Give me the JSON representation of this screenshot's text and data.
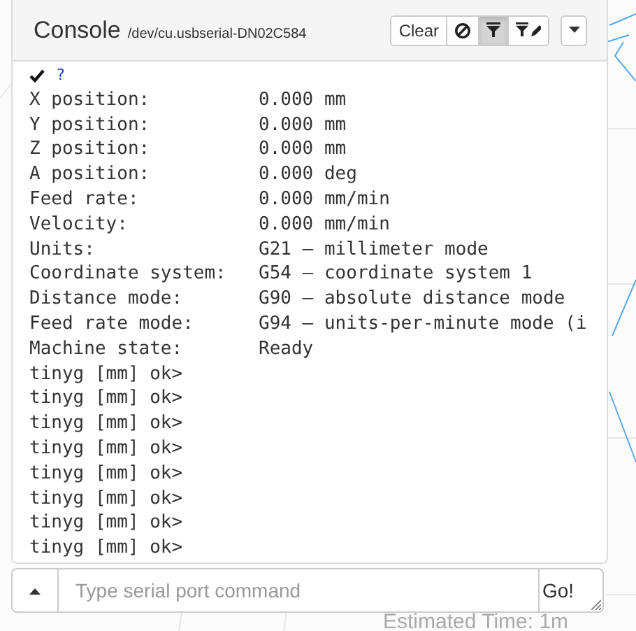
{
  "console": {
    "title": "Console",
    "port": "/dev/cu.usbserial-DN02C584",
    "toolbar": [
      {
        "kind": "text",
        "label": "Clear",
        "selected": false
      },
      {
        "kind": "ban",
        "selected": false
      },
      {
        "kind": "filter",
        "selected": true
      },
      {
        "kind": "filter-edit",
        "selected": false
      }
    ],
    "log": [
      {
        "kind": "check",
        "text": "?"
      },
      {
        "kind": "pair",
        "key": "X position:",
        "value": "0.000 mm"
      },
      {
        "kind": "pair",
        "key": "Y position:",
        "value": "0.000 mm"
      },
      {
        "kind": "pair",
        "key": "Z position:",
        "value": "0.000 mm"
      },
      {
        "kind": "pair",
        "key": "A position:",
        "value": "0.000 deg"
      },
      {
        "kind": "pair",
        "key": "Feed rate:",
        "value": "0.000 mm/min"
      },
      {
        "kind": "pair",
        "key": "Velocity:",
        "value": "0.000 mm/min"
      },
      {
        "kind": "pair",
        "key": "Units:",
        "value": "G21 – millimeter mode"
      },
      {
        "kind": "pair",
        "key": "Coordinate system:",
        "value": "G54 – coordinate system 1"
      },
      {
        "kind": "pair",
        "key": "Distance mode:",
        "value": "G90 – absolute distance mode"
      },
      {
        "kind": "pair",
        "key": "Feed rate mode:",
        "value": "G94 – units-per-minute mode (i"
      },
      {
        "kind": "pair",
        "key": "Machine state:",
        "value": "Ready"
      },
      {
        "kind": "line",
        "text": "tinyg [mm] ok>"
      },
      {
        "kind": "line",
        "text": "tinyg [mm] ok>"
      },
      {
        "kind": "line",
        "text": "tinyg [mm] ok>"
      },
      {
        "kind": "line",
        "text": "tinyg [mm] ok>"
      },
      {
        "kind": "line",
        "text": "tinyg [mm] ok>"
      },
      {
        "kind": "line",
        "text": "tinyg [mm] ok>"
      },
      {
        "kind": "line",
        "text": "tinyg [mm] ok>"
      },
      {
        "kind": "line",
        "text": "tinyg [mm] ok>"
      }
    ],
    "command": {
      "placeholder": "Type serial port command",
      "submit": "Go!"
    }
  },
  "estimate": "Estimated Time: 1m"
}
